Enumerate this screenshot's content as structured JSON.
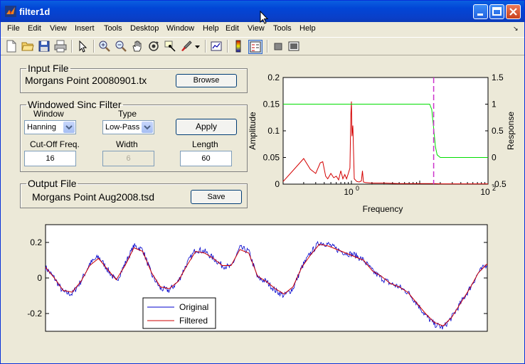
{
  "window": {
    "title": "filter1d"
  },
  "menu": [
    "File",
    "Edit",
    "View",
    "Insert",
    "Tools",
    "Desktop",
    "Window",
    "Help",
    "Edit",
    "View",
    "Tools",
    "Help"
  ],
  "toolbar_icons": [
    "new-file-icon",
    "open-folder-icon",
    "save-icon",
    "print-icon",
    "pointer-icon",
    "zoom-in-icon",
    "zoom-out-icon",
    "pan-hand-icon",
    "rotate-3d-icon",
    "data-cursor-icon",
    "brush-icon",
    "brush-dropdown-icon",
    "link-plot-icon",
    "colorbar-icon",
    "legend-icon",
    "hide-plot-tools-icon",
    "show-plot-tools-icon"
  ],
  "input_file": {
    "legend": "Input File",
    "filename": "Morgans  Point  20080901.tx",
    "browse_label": "Browse"
  },
  "filter": {
    "legend": "Windowed Sinc Filter",
    "window_label": "Window",
    "window_value": "Hanning",
    "type_label": "Type",
    "type_value": "Low-Pass",
    "apply_label": "Apply",
    "cutoff_label": "Cut-Off Freq.",
    "cutoff_value": "16",
    "width_label": "Width",
    "width_value": "6",
    "length_label": "Length",
    "length_value": "60"
  },
  "output_file": {
    "legend": "Output File",
    "filename": "Morgans  Point  Aug2008.tsd",
    "save_label": "Save"
  },
  "colors": {
    "amplitude": "#d40000",
    "response": "#00dd00",
    "cutoff": "#cc33cc",
    "original": "#0000cc",
    "filtered": "#cc0000"
  },
  "chart_data": [
    {
      "type": "line",
      "xscale": "log",
      "xlabel": "Frequency",
      "ylabel": "Amplitude",
      "y2label": "Response",
      "xlim": [
        0.1,
        100
      ],
      "ylim": [
        0,
        0.2
      ],
      "y2lim": [
        -0.5,
        1.5
      ],
      "xtick_labels": [
        {
          "base": "10",
          "exp": "0",
          "value": 1
        },
        {
          "base": "10",
          "exp": "2",
          "value": 100
        }
      ],
      "yticks": [
        "0",
        "0.05",
        "0.1",
        "0.15",
        "0.2"
      ],
      "y2ticks": [
        "-0.5",
        "0",
        "0.5",
        "1",
        "1.5"
      ],
      "cutoff_frequency": 16,
      "series": [
        {
          "axis": "left",
          "x": [
            0.1,
            0.15,
            0.2,
            0.25,
            0.3,
            0.35,
            0.38,
            0.42,
            0.45,
            0.5,
            0.55,
            0.6,
            0.65,
            0.7,
            0.75,
            0.8,
            0.85,
            0.9,
            0.95,
            0.98,
            1.0,
            1.02,
            1.05,
            1.1,
            1.2,
            1.3,
            1.4,
            1.45,
            1.5,
            1.6,
            2,
            3,
            5,
            8,
            12,
            16,
            20,
            30,
            50,
            100
          ],
          "y": [
            0.005,
            0.03,
            0.048,
            0.028,
            0.02,
            0.04,
            0.042,
            0.015,
            0.01,
            0.02,
            0.012,
            0.015,
            0.008,
            0.025,
            0.01,
            0.018,
            0.01,
            0.02,
            0.03,
            0.13,
            0.155,
            0.09,
            0.11,
            0.01,
            0.005,
            0.004,
            0.006,
            0.025,
            0.004,
            0.003,
            0.002,
            0.002,
            0.001,
            0.001,
            0.001,
            0.001,
            0.0005,
            0.0005,
            0.0005,
            0.0005
          ]
        },
        {
          "axis": "right",
          "x": [
            0.1,
            1,
            5,
            10,
            14,
            15,
            16,
            17,
            18,
            20,
            30,
            50,
            100
          ],
          "y": [
            1,
            1,
            1,
            1,
            1,
            0.9,
            0.55,
            0.2,
            0.05,
            0,
            0,
            0,
            0
          ]
        }
      ]
    },
    {
      "type": "line",
      "yticks": [
        "0.2",
        "0",
        "-0.2"
      ],
      "ylim": [
        -0.3,
        0.3
      ],
      "legend": [
        "Original",
        "Filtered"
      ],
      "legend_position": "bottom-left",
      "x": [
        0,
        0.02,
        0.04,
        0.06,
        0.08,
        0.1,
        0.12,
        0.14,
        0.16,
        0.18,
        0.2,
        0.22,
        0.24,
        0.26,
        0.28,
        0.3,
        0.32,
        0.34,
        0.36,
        0.38,
        0.4,
        0.42,
        0.44,
        0.46,
        0.48,
        0.5,
        0.52,
        0.54,
        0.56,
        0.58,
        0.6,
        0.62,
        0.64,
        0.66,
        0.68,
        0.7,
        0.72,
        0.74,
        0.76,
        0.78,
        0.8,
        0.82,
        0.84,
        0.86,
        0.88,
        0.9,
        0.92,
        0.94,
        0.96,
        0.98,
        1.0
      ],
      "series": [
        {
          "name": "Original",
          "y": [
            0.06,
            0.0,
            -0.08,
            -0.09,
            -0.02,
            0.08,
            0.12,
            0.05,
            -0.02,
            0.08,
            0.18,
            0.16,
            0.02,
            -0.06,
            -0.07,
            -0.02,
            0.08,
            0.16,
            0.15,
            0.11,
            0.07,
            0.06,
            0.17,
            0.15,
            0.0,
            -0.02,
            -0.07,
            -0.1,
            -0.06,
            0.06,
            0.14,
            0.2,
            0.19,
            0.16,
            0.14,
            0.13,
            0.1,
            0.04,
            0.0,
            -0.03,
            -0.05,
            -0.08,
            -0.14,
            -0.21,
            -0.26,
            -0.28,
            -0.22,
            -0.14,
            -0.06,
            0.03,
            0.08
          ]
        },
        {
          "name": "Filtered",
          "y": [
            0.06,
            0.0,
            -0.07,
            -0.08,
            -0.02,
            0.07,
            0.11,
            0.05,
            -0.01,
            0.07,
            0.17,
            0.15,
            0.03,
            -0.05,
            -0.06,
            -0.02,
            0.07,
            0.15,
            0.14,
            0.11,
            0.07,
            0.07,
            0.16,
            0.14,
            0.01,
            -0.02,
            -0.06,
            -0.09,
            -0.05,
            0.06,
            0.13,
            0.19,
            0.18,
            0.16,
            0.14,
            0.12,
            0.1,
            0.04,
            0.01,
            -0.03,
            -0.05,
            -0.08,
            -0.14,
            -0.2,
            -0.25,
            -0.27,
            -0.22,
            -0.14,
            -0.06,
            0.03,
            0.08
          ]
        }
      ]
    }
  ]
}
